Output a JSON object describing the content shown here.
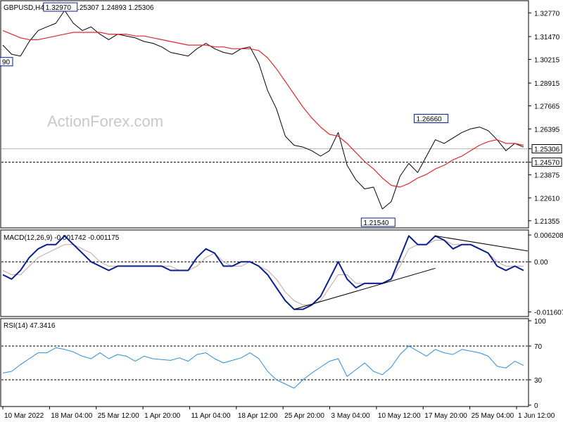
{
  "chart_data": {
    "type": "line",
    "price_panel": {
      "header": "GBPUSD,H4  1.24984 1.25307 1.24893 1.25306",
      "watermark": "ActionForex.com",
      "y_ticks": [
        "1.32770",
        "1.31470",
        "1.30215",
        "1.28915",
        "1.27665",
        "1.26395",
        "1.25306",
        "1.24570",
        "1.23875",
        "1.22610",
        "1.21355"
      ],
      "ylim": [
        1.21,
        1.334
      ],
      "current_price": 1.25306,
      "support_level": 1.2457,
      "current_price_label": "1.25306",
      "support_label": "1.24570",
      "annotations": [
        {
          "text": "1.32970",
          "price": 1.3297,
          "index": 7
        },
        {
          "text": "90",
          "price": 1.3009,
          "index": 0
        },
        {
          "text": "1.26660",
          "price": 1.2666,
          "index": 49
        },
        {
          "text": "1.21540",
          "price": 1.2154,
          "index": 43
        }
      ],
      "close_series": [
        1.31,
        1.305,
        1.304,
        1.312,
        1.318,
        1.32,
        1.322,
        1.329,
        1.322,
        1.318,
        1.32,
        1.316,
        1.313,
        1.316,
        1.315,
        1.314,
        1.312,
        1.311,
        1.309,
        1.306,
        1.305,
        1.304,
        1.308,
        1.311,
        1.308,
        1.306,
        1.305,
        1.308,
        1.309,
        1.3,
        1.285,
        1.275,
        1.26,
        1.255,
        1.254,
        1.252,
        1.249,
        1.252,
        1.262,
        1.244,
        1.236,
        1.231,
        1.232,
        1.22,
        1.224,
        1.238,
        1.245,
        1.24,
        1.249,
        1.258,
        1.256,
        1.259,
        1.262,
        1.264,
        1.265,
        1.263,
        1.258,
        1.252,
        1.256,
        1.254
      ],
      "ma_series": [
        1.318,
        1.316,
        1.314,
        1.313,
        1.313,
        1.314,
        1.315,
        1.316,
        1.317,
        1.317,
        1.317,
        1.317,
        1.316,
        1.316,
        1.316,
        1.315,
        1.315,
        1.314,
        1.313,
        1.312,
        1.311,
        1.31,
        1.31,
        1.31,
        1.309,
        1.309,
        1.308,
        1.308,
        1.308,
        1.307,
        1.303,
        1.297,
        1.29,
        1.283,
        1.276,
        1.27,
        1.265,
        1.261,
        1.26,
        1.256,
        1.251,
        1.246,
        1.242,
        1.237,
        1.233,
        1.232,
        1.234,
        1.237,
        1.239,
        1.242,
        1.244,
        1.247,
        1.249,
        1.252,
        1.255,
        1.257,
        1.258,
        1.256,
        1.256,
        1.255
      ]
    },
    "macd_panel": {
      "label": "MACD(12,26,9) -0.001742 -0.001175",
      "y_ticks": [
        "0.006208",
        "0.00",
        "-0.011607"
      ],
      "ylim": [
        -0.0125,
        0.0072
      ],
      "macd_series": [
        -0.003,
        -0.004,
        -0.002,
        0.001,
        0.003,
        0.004,
        0.004,
        0.006,
        0.004,
        0.002,
        0.0,
        -0.001,
        -0.002,
        -0.001,
        -0.001,
        -0.001,
        -0.001,
        -0.001,
        -0.001,
        -0.002,
        -0.002,
        -0.002,
        0.001,
        0.003,
        0.002,
        -0.001,
        -0.001,
        0.0,
        0.0,
        -0.001,
        -0.003,
        -0.006,
        -0.009,
        -0.011,
        -0.011,
        -0.01,
        -0.008,
        -0.004,
        0.0,
        -0.004,
        -0.006,
        -0.005,
        -0.005,
        -0.005,
        -0.004,
        0.001,
        0.006,
        0.004,
        0.004,
        0.006,
        0.005,
        0.003,
        0.004,
        0.004,
        0.003,
        0.002,
        -0.001,
        -0.002,
        -0.001,
        -0.002
      ],
      "signal_series": [
        -0.002,
        -0.003,
        -0.003,
        -0.001,
        0.001,
        0.002,
        0.003,
        0.004,
        0.004,
        0.003,
        0.002,
        0.0,
        -0.001,
        -0.001,
        -0.001,
        -0.001,
        -0.001,
        -0.001,
        -0.001,
        -0.001,
        -0.002,
        -0.002,
        -0.001,
        0.001,
        0.002,
        0.0,
        -0.001,
        -0.001,
        0.0,
        -0.001,
        -0.002,
        -0.004,
        -0.007,
        -0.009,
        -0.01,
        -0.01,
        -0.009,
        -0.006,
        -0.003,
        -0.003,
        -0.005,
        -0.005,
        -0.005,
        -0.005,
        -0.004,
        -0.001,
        0.003,
        0.004,
        0.004,
        0.005,
        0.005,
        0.004,
        0.004,
        0.004,
        0.003,
        0.002,
        0.0,
        -0.001,
        -0.001,
        -0.001
      ]
    },
    "rsi_panel": {
      "label": "RSI(14) 47.3416",
      "y_ticks": [
        "100",
        "70",
        "30",
        "0"
      ],
      "ylim": [
        0,
        100
      ],
      "levels": [
        70,
        30
      ],
      "rsi_series": [
        38,
        40,
        48,
        55,
        62,
        62,
        68,
        66,
        63,
        58,
        55,
        62,
        55,
        60,
        58,
        52,
        58,
        55,
        54,
        53,
        56,
        52,
        60,
        62,
        55,
        50,
        53,
        56,
        62,
        55,
        40,
        30,
        25,
        20,
        30,
        38,
        45,
        52,
        55,
        34,
        42,
        50,
        40,
        36,
        45,
        60,
        70,
        64,
        58,
        66,
        62,
        60,
        66,
        64,
        62,
        58,
        46,
        44,
        52,
        47
      ]
    },
    "x_tick_labels": [
      "10 Mar 2022",
      "18 Mar 04:00",
      "25 Mar 12:00",
      "1 Apr 20:00",
      "11 Apr 04:00",
      "18 Apr 12:00",
      "25 Apr 20:00",
      "3 May 04:00",
      "10 May 12:00",
      "17 May 20:00",
      "25 May 04:00",
      "1 Jun 12:00"
    ],
    "colors": {
      "price": "#000000",
      "ma": "#e0282c",
      "macd": "#0a1f8f",
      "signal": "#c8a0a0",
      "grid": "#000000",
      "label_fill": "#ffffff"
    }
  }
}
